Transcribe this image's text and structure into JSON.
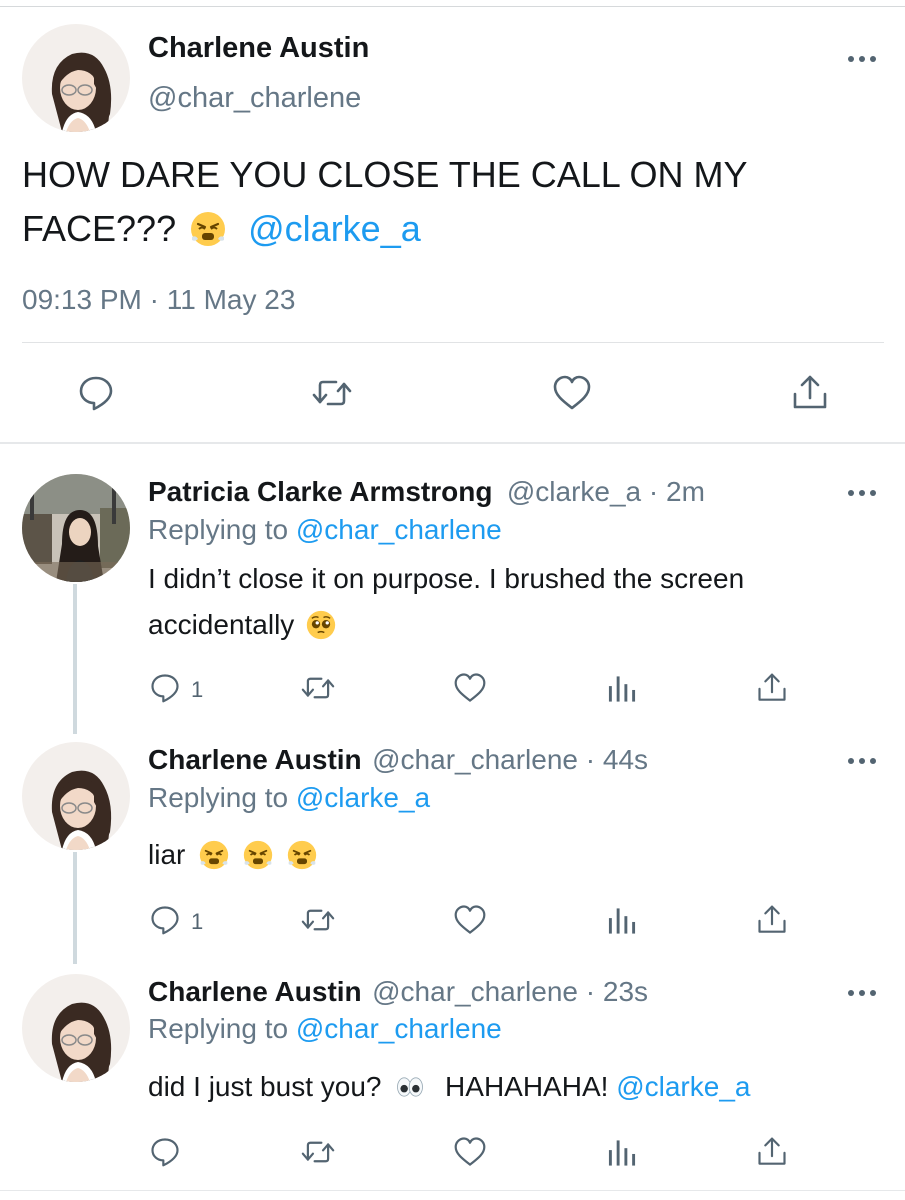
{
  "main_tweet": {
    "author_name": "Charlene Austin",
    "author_handle": "@char_charlene",
    "text": "HOW DARE YOU CLOSE THE CALL ON MY FACE???",
    "emoji": "huffing-face",
    "mention": "@clarke_a",
    "timestamp": "09:13 PM · 11 May 23",
    "actions": [
      "reply",
      "retweet",
      "like",
      "share"
    ]
  },
  "replies": [
    {
      "author_name": "Patricia Clarke Armstrong",
      "handle_time": "@clarke_a · 2m",
      "replying_label": "Replying to",
      "replying_to": "@char_charlene",
      "text_line1": "I didn’t close it on purpose. I brushed the screen",
      "text_line2": "accidentally",
      "emoji": "pleading-face",
      "reply_count": "1"
    },
    {
      "author_name": "Charlene Austin",
      "handle_time": "@char_charlene · 44s",
      "replying_label": "Replying to",
      "replying_to": "@clarke_a",
      "text": "liar",
      "emoji": "huffing-face x3",
      "reply_count": "1"
    },
    {
      "author_name": "Charlene Austin",
      "handle_time": "@char_charlene · 23s",
      "replying_label": "Replying to",
      "replying_to": "@char_charlene",
      "text": "did I just bust you?",
      "emoji": "eyes",
      "text_after": "HAHAHAHA!",
      "mention": "@clarke_a"
    }
  ],
  "colors": {
    "link": "#1d9bf0",
    "secondary_text": "#657786",
    "divider": "#e1e3e5",
    "icon": "#536471"
  }
}
